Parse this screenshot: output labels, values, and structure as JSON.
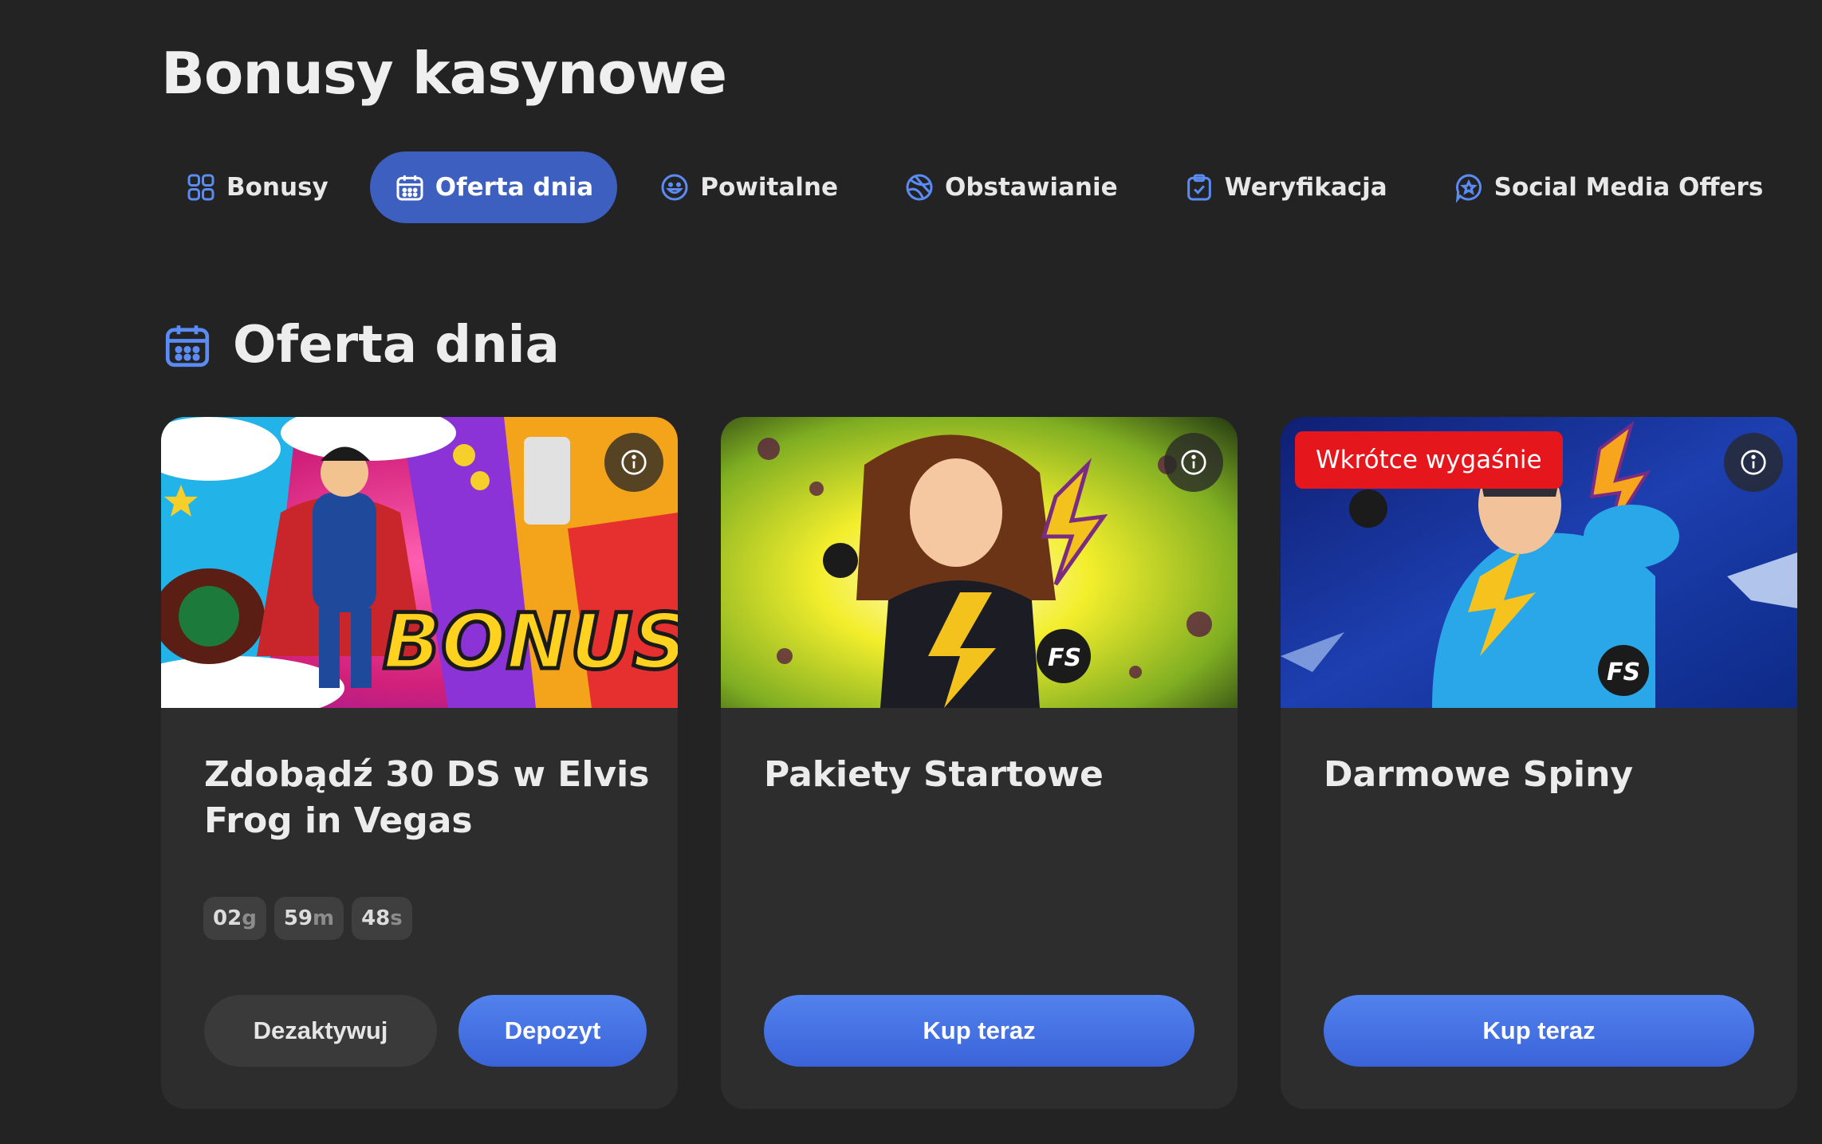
{
  "page": {
    "title": "Bonusy kasynowe"
  },
  "tabs": [
    {
      "label": "Bonusy",
      "icon": "grid-icon",
      "active": false
    },
    {
      "label": "Oferta dnia",
      "icon": "calendar-icon",
      "active": true
    },
    {
      "label": "Powitalne",
      "icon": "smiley-icon",
      "active": false
    },
    {
      "label": "Obstawianie",
      "icon": "ball-icon",
      "active": false
    },
    {
      "label": "Weryfikacja",
      "icon": "clipboard-check-icon",
      "active": false
    },
    {
      "label": "Social Media Offers",
      "icon": "star-badge-icon",
      "active": false
    }
  ],
  "section": {
    "title": "Oferta dnia",
    "icon": "calendar-icon"
  },
  "colors": {
    "accent": "#3d5fbf",
    "primary_button": "#4873e3",
    "badge_red": "#e5161c",
    "background": "#232323",
    "card": "#2d2d2d"
  },
  "cards": [
    {
      "title": "Zdobądź 30 DS w Elvis Frog in Vegas",
      "image_text": "BONUS",
      "timer": [
        {
          "value": "02",
          "unit": "g"
        },
        {
          "value": "59",
          "unit": "m"
        },
        {
          "value": "48",
          "unit": "s"
        }
      ],
      "secondary_label": "Dezaktywuj",
      "primary_label": "Depozyt"
    },
    {
      "title": "Pakiety Startowe",
      "image_text": "FS",
      "primary_label": "Kup teraz"
    },
    {
      "title": "Darmowe Spiny",
      "badge": "Wkrótce wygaśnie",
      "image_text": "FS",
      "primary_label": "Kup teraz"
    }
  ]
}
